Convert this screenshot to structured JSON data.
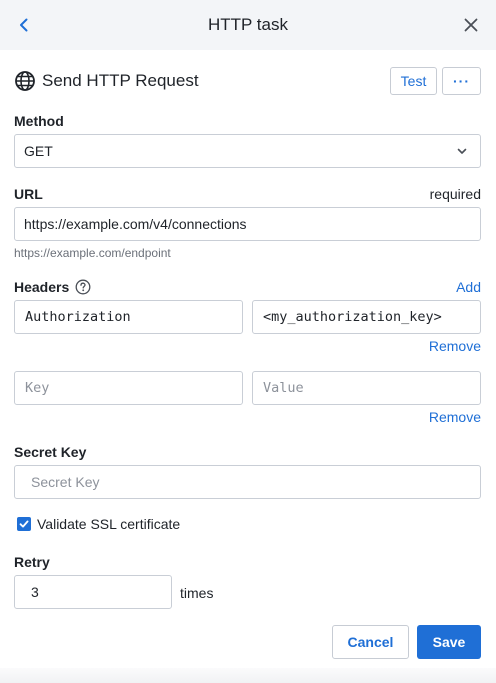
{
  "header": {
    "title": "HTTP task"
  },
  "task": {
    "title": "Send HTTP Request",
    "test_label": "Test",
    "more_label": "···"
  },
  "method": {
    "label": "Method",
    "value": "GET"
  },
  "url": {
    "label": "URL",
    "required_label": "required",
    "value": "https://example.com/v4/connections",
    "helper": "https://example.com/endpoint"
  },
  "headers": {
    "label": "Headers",
    "add_label": "Add",
    "rows": [
      {
        "key": "Authorization",
        "value": "<my_authorization_key>",
        "remove_label": "Remove"
      },
      {
        "key_placeholder": "Key",
        "value_placeholder": "Value",
        "remove_label": "Remove"
      }
    ]
  },
  "secret_key": {
    "label": "Secret Key",
    "placeholder": "Secret Key"
  },
  "ssl": {
    "label": "Validate SSL certificate",
    "checked": true
  },
  "retry": {
    "label": "Retry",
    "value": "3",
    "unit": "times"
  },
  "footer": {
    "cancel_label": "Cancel",
    "save_label": "Save"
  },
  "colors": {
    "accent": "#1f6fd6",
    "header_bg": "#f3f5f8",
    "border": "#c9ced6"
  },
  "icons": {
    "back": "chevron-left-icon",
    "close": "close-icon",
    "globe": "globe-icon",
    "help": "help-circle-icon",
    "dropdown": "chevron-down-icon",
    "check": "check-icon"
  }
}
